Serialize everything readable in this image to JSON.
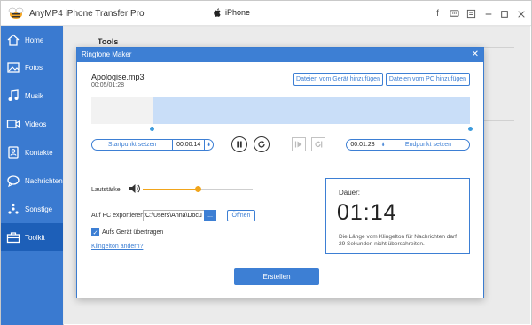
{
  "app": {
    "title": "AnyMP4 iPhone Transfer Pro",
    "device": "iPhone"
  },
  "window_controls": [
    "facebook-icon",
    "feedback-icon",
    "menu-icon",
    "minimize-icon",
    "maximize-icon",
    "close-icon"
  ],
  "sidebar": {
    "items": [
      {
        "label": "Home",
        "icon": "home-icon",
        "active": false
      },
      {
        "label": "Fotos",
        "icon": "photo-icon",
        "active": false
      },
      {
        "label": "Musik",
        "icon": "music-icon",
        "active": false
      },
      {
        "label": "Videos",
        "icon": "video-icon",
        "active": false
      },
      {
        "label": "Kontakte",
        "icon": "contacts-icon",
        "active": false
      },
      {
        "label": "Nachrichten",
        "icon": "messages-icon",
        "active": false
      },
      {
        "label": "Sonstige",
        "icon": "other-icon",
        "active": false
      },
      {
        "label": "Toolkit",
        "icon": "toolkit-icon",
        "active": true
      }
    ]
  },
  "main": {
    "section_title": "Tools"
  },
  "dialog": {
    "title": "Ringtone Maker",
    "file_name": "Apologise.mp3",
    "file_duration": "00:05/01:28",
    "add_from_device": "Dateien vom Gerät hinzufügen",
    "add_from_pc": "Dateien vom PC hinzufügen",
    "start": {
      "label": "Startpunkt setzen",
      "time": "00:00:14"
    },
    "end": {
      "label": "Endpunkt setzen",
      "time": "00:01:28"
    },
    "volume_label": "Lautstärke:",
    "volume_level": 0.5,
    "export_label": "Auf PC exportieren:",
    "export_path": "C:\\Users\\Anna\\Docu",
    "browse_label": "...",
    "open_label": "Öffnen",
    "transfer_checked": true,
    "transfer_label": "Aufs Gerät übertragen",
    "change_link": "Klingelton ändern?",
    "duration_title": "Dauer:",
    "duration_value": "01:14",
    "duration_note": "Die Länge vom Klingelton für Nachrichten darf 29 Sekunden nicht überschreiten.",
    "create_label": "Erstellen"
  },
  "colors": {
    "accent": "#3d7fd4",
    "sidebar": "#3a7ad0",
    "sidebar_active": "#1d5fb8",
    "slider": "#f1a51b"
  }
}
